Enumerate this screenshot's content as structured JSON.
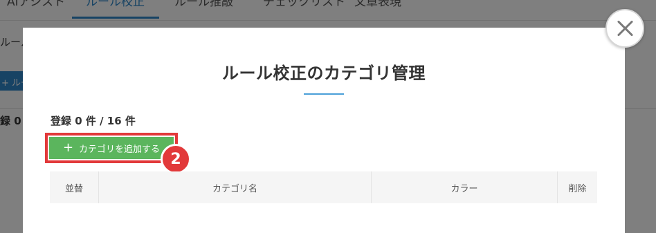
{
  "background": {
    "tabs": [
      "AIアシスト",
      "ルール校正",
      "ルール推敲",
      "チェックリスト",
      "文章表現"
    ],
    "active_tab_index": 1,
    "side_text_1": "ルール",
    "side_chip": "+ ルー",
    "side_text_2": "録 0"
  },
  "modal": {
    "title": "ルール校正のカテゴリ管理",
    "count_label": "登録 0 件 / 16 件",
    "add_button": {
      "icon": "plus-icon",
      "label": "カテゴリを追加する"
    },
    "step_badge": "2",
    "table": {
      "headers": [
        "並替",
        "カテゴリ名",
        "カラー",
        "削除"
      ]
    },
    "close_icon": "close-icon"
  },
  "colors": {
    "accent_blue": "#2f86c9",
    "add_button_green": "#5bb55d",
    "highlight_red": "#e2393a"
  }
}
